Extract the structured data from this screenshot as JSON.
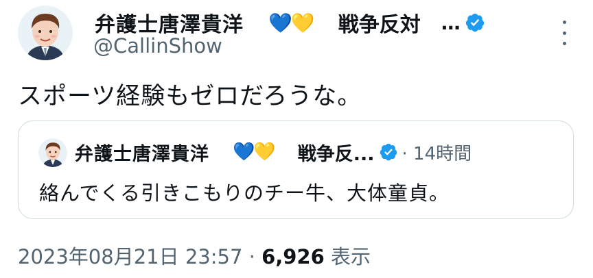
{
  "author": {
    "name": "弁護士唐澤貴洋",
    "hearts": "💙💛",
    "name_tail": "戦争反対",
    "ellipsis": "…",
    "handle": "@CallinShow"
  },
  "tweet": {
    "text": "スポーツ経験もゼロだろうな。"
  },
  "quote": {
    "name": "弁護士唐澤貴洋",
    "hearts": "💙💛",
    "name_tail": "戦争反...",
    "time": "· 14時間",
    "text": "絡んでくる引きこもりのチー牛、大体童貞。"
  },
  "footer": {
    "datetime": "2023年08月21日 23:57",
    "sep": " · ",
    "views": "6,926",
    "views_label": " 表示"
  },
  "colors": {
    "verified": "#1d9bf0",
    "secondary_text": "#536471",
    "border": "#cfd9de"
  },
  "icons": {
    "verified": "verified-badge-icon",
    "more": "more-options-icon"
  }
}
